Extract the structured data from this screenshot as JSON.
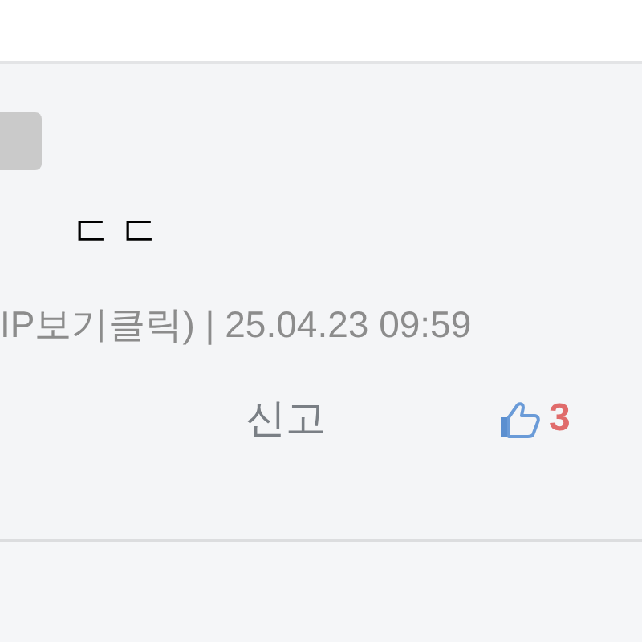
{
  "comment": {
    "body": "ㄷㄷ",
    "meta": "IP보기클릭) | 25.04.23 09:59",
    "report_label": "신고",
    "likes": "3"
  }
}
